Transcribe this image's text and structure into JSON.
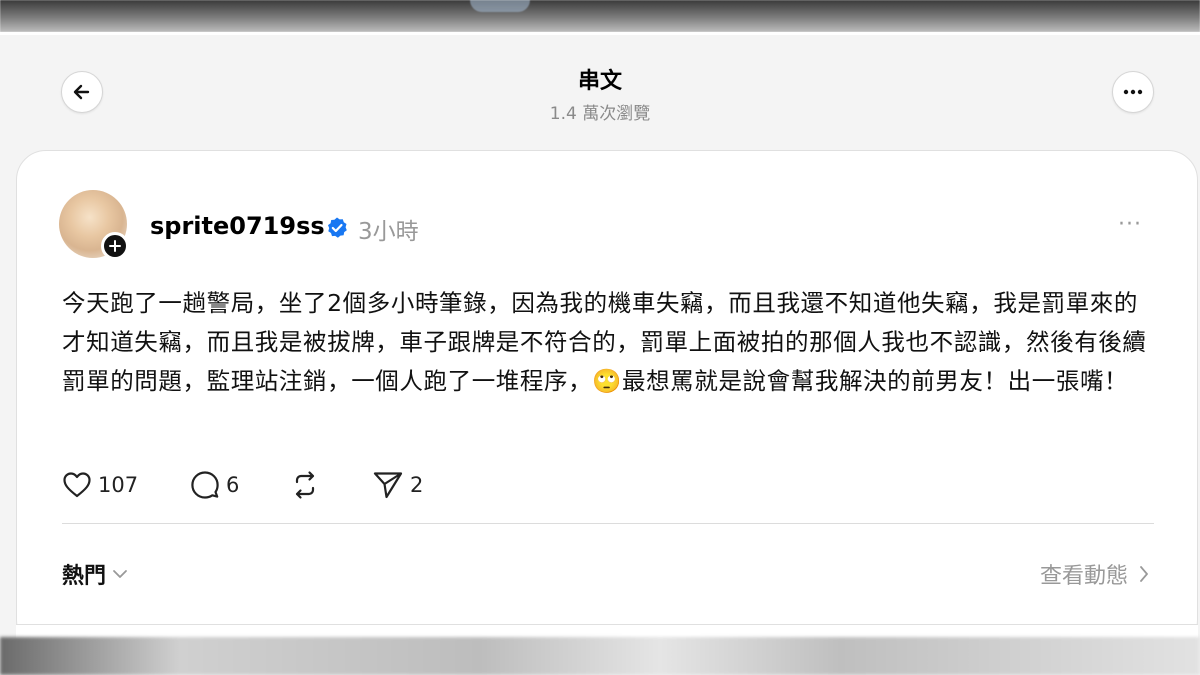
{
  "header": {
    "title": "串文",
    "views": "1.4 萬次瀏覽"
  },
  "icons": {
    "back": "arrow-left-icon",
    "more": "more-horizontal-icon",
    "follow": "plus-icon",
    "verified": "verified-badge-icon",
    "like": "heart-icon",
    "comment": "comment-icon",
    "repost": "repost-icon",
    "share": "send-icon",
    "sort": "chevron-down-icon",
    "activity": "chevron-right-icon"
  },
  "post": {
    "username": "sprite0719ss",
    "time": "3小時",
    "more_label": "···",
    "text": "今天跑了一趟警局，坐了2個多小時筆錄，因為我的機車失竊，而且我還不知道他失竊，我是罰單來的才知道失竊，而且我是被拔牌，車子跟牌是不符合的，罰單上面被拍的那個人我也不認識，然後有後續罰單的問題，監理站注銷，一個人跑了一堆程序，🙄最想罵就是說會幫我解決的前男友！出一張嘴！",
    "likes": "107",
    "comments": "6",
    "shares": "2"
  },
  "replies": {
    "sort_label": "熱門",
    "activity_label": "查看動態"
  },
  "colors": {
    "verified": "#1877f2",
    "muted": "#999999",
    "card": "#ffffff",
    "page_bg": "#f4f4f4"
  }
}
